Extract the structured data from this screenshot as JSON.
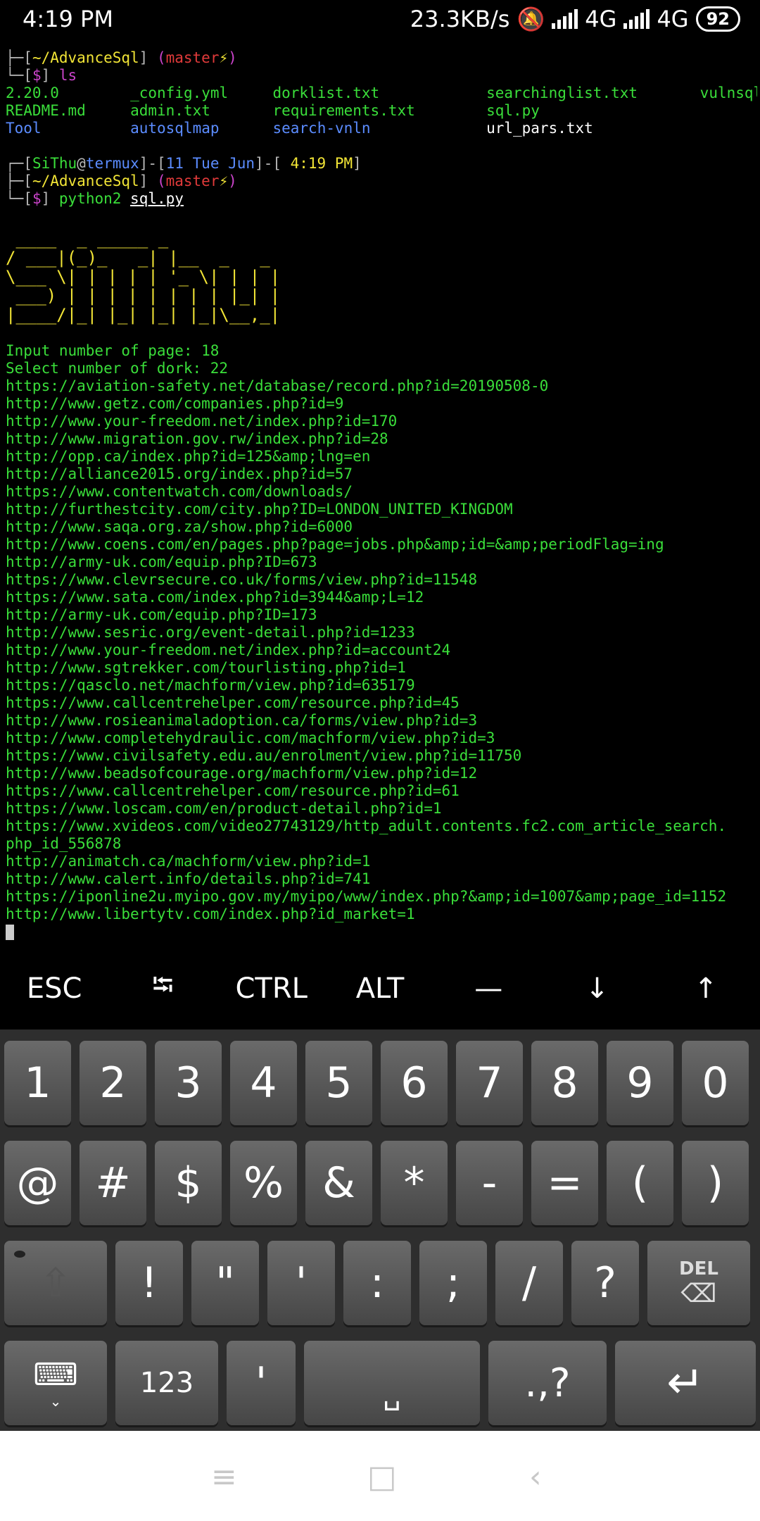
{
  "status_bar": {
    "time": "4:19 PM",
    "net_speed": "23.3KB/s",
    "net1": "4G",
    "net2": "4G",
    "battery": "92"
  },
  "terminal": {
    "header1": {
      "dir": "~/AdvanceSql",
      "branch": "master",
      "bolt": "⚡"
    },
    "prompt_symbol": "$",
    "cmd_ls": "ls",
    "ls_rows": [
      [
        "2.20.0",
        "_config.yml",
        "dorklist.txt",
        "searchinglist.txt",
        "vulnsql.txt"
      ],
      [
        "README.md",
        "admin.txt",
        "requirements.txt",
        "sql.py",
        ""
      ],
      [
        "Tool",
        "autosqlmap",
        "search-vnln",
        "url_pars.txt",
        ""
      ]
    ],
    "header2": {
      "user": "SiThu",
      "host": "termux",
      "date": "11 Tue Jun",
      "time": "4:19 PM"
    },
    "header3": {
      "dir": "~/AdvanceSql",
      "branch": "master",
      "bolt": "⚡"
    },
    "cmd_py_prefix": "python2 ",
    "cmd_py_file": "sql.py",
    "banner": [
      " ____  _ _____ _",
      "/ ___|(_)_   _| |__  _   _",
      "\\___ \\| | | | | '_ \\| | | |",
      " ___) | | | | | | | | |_| |",
      "|____/|_| |_| |_| |_|\\__,_|"
    ],
    "output": [
      "Input number of page: 18",
      "Select number of dork: 22",
      "https://aviation-safety.net/database/record.php?id=20190508-0",
      "http://www.getz.com/companies.php?id=9",
      "http://www.your-freedom.net/index.php?id=170",
      "http://www.migration.gov.rw/index.php?id=28",
      "http://opp.ca/index.php?id=125&amp;lng=en",
      "http://alliance2015.org/index.php?id=57",
      "https://www.contentwatch.com/downloads/",
      "http://furthestcity.com/city.php?ID=LONDON_UNITED_KINGDOM",
      "http://www.saqa.org.za/show.php?id=6000",
      "http://www.coens.com/en/pages.php?page=jobs.php&amp;id=&amp;periodFlag=ing",
      "http://army-uk.com/equip.php?ID=673",
      "https://www.clevrsecure.co.uk/forms/view.php?id=11548",
      "https://www.sata.com/index.php?id=3944&amp;L=12",
      "http://army-uk.com/equip.php?ID=173",
      "http://www.sesric.org/event-detail.php?id=1233",
      "http://www.your-freedom.net/index.php?id=account24",
      "http://www.sgtrekker.com/tourlisting.php?id=1",
      "https://qasclo.net/machform/view.php?id=635179",
      "https://www.callcentrehelper.com/resource.php?id=45",
      "http://www.rosieanimaladoption.ca/forms/view.php?id=3",
      "http://www.completehydraulic.com/machform/view.php?id=3",
      "https://www.civilsafety.edu.au/enrolment/view.php?id=11750",
      "http://www.beadsofcourage.org/machform/view.php?id=12",
      "https://www.callcentrehelper.com/resource.php?id=61",
      "https://www.loscam.com/en/product-detail.php?id=1",
      "https://www.xvideos.com/video27743129/http_adult.contents.fc2.com_article_search.",
      "php_id_556878",
      "http://animatch.ca/machform/view.php?id=1",
      "http://www.calert.info/details.php?id=741",
      "https://iponline2u.myipo.gov.my/myipo/www/index.php?&amp;id=1007&amp;page_id=1152",
      "http://www.libertytv.com/index.php?id_market=1"
    ]
  },
  "extra_keys": [
    "ESC",
    "⭾",
    "CTRL",
    "ALT",
    "—",
    "↓",
    "↑"
  ],
  "keyboard": {
    "row1": [
      "1",
      "2",
      "3",
      "4",
      "5",
      "6",
      "7",
      "8",
      "9",
      "0"
    ],
    "row2": [
      "@",
      "#",
      "$",
      "%",
      "&",
      "*",
      "-",
      "=",
      "(",
      ")"
    ],
    "row3": [
      "!",
      "\"",
      "'",
      ":",
      ";",
      "/",
      "?"
    ],
    "del_label": "DEL",
    "numbers_label": "123",
    "apostrophe": "'",
    "punct_label": ".,?"
  }
}
